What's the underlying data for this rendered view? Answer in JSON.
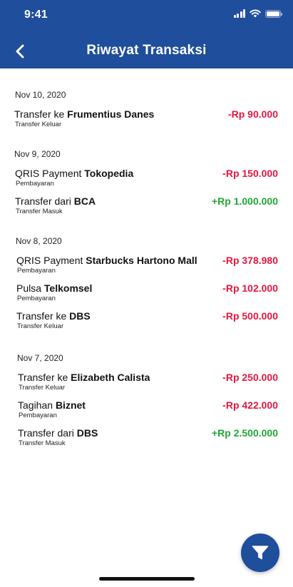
{
  "status_bar": {
    "time": "9:41"
  },
  "header": {
    "title": "Riwayat Transaksi",
    "back_icon": "chevron-left-icon"
  },
  "colors": {
    "primary": "#1f4e9c",
    "debit": "#e4163f",
    "credit": "#1ea836"
  },
  "groups": [
    {
      "date": "Nov 10, 2020",
      "items": [
        {
          "prefix": "Transfer ke",
          "name": "Frumentius Danes",
          "type": "Transfer Keluar",
          "amount": "-Rp 90.000",
          "direction": "debit"
        }
      ]
    },
    {
      "date": "Nov 9, 2020",
      "items": [
        {
          "prefix": "QRIS Payment",
          "name": "Tokopedia",
          "type": "Pembayaran",
          "amount": "-Rp 150.000",
          "direction": "debit"
        },
        {
          "prefix": "Transfer dari",
          "name": "BCA",
          "type": "Transfer Masuk",
          "amount": "+Rp 1.000.000",
          "direction": "credit"
        }
      ]
    },
    {
      "date": "Nov 8, 2020",
      "items": [
        {
          "prefix": "QRIS Payment",
          "name": "Starbucks Hartono Mall",
          "type": "Pembayaran",
          "amount": "-Rp 378.980",
          "direction": "debit"
        },
        {
          "prefix": "Pulsa",
          "name": "Telkomsel",
          "type": "Pembayaran",
          "amount": "-Rp 102.000",
          "direction": "debit"
        },
        {
          "prefix": "Transfer ke",
          "name": "DBS",
          "type": "Transfer Keluar",
          "amount": "-Rp 500.000",
          "direction": "debit"
        }
      ]
    },
    {
      "date": "Nov 7, 2020",
      "items": [
        {
          "prefix": "Transfer ke",
          "name": "Elizabeth Calista",
          "type": "Transfer Keluar",
          "amount": "-Rp 250.000",
          "direction": "debit"
        },
        {
          "prefix": "Tagihan",
          "name": "Biznet",
          "type": "Pembayaran",
          "amount": "-Rp 422.000",
          "direction": "debit"
        },
        {
          "prefix": "Transfer dari",
          "name": "DBS",
          "type": "Transfer Masuk",
          "amount": "+Rp 2.500.000",
          "direction": "credit"
        }
      ]
    }
  ],
  "fab": {
    "icon": "filter-icon"
  }
}
